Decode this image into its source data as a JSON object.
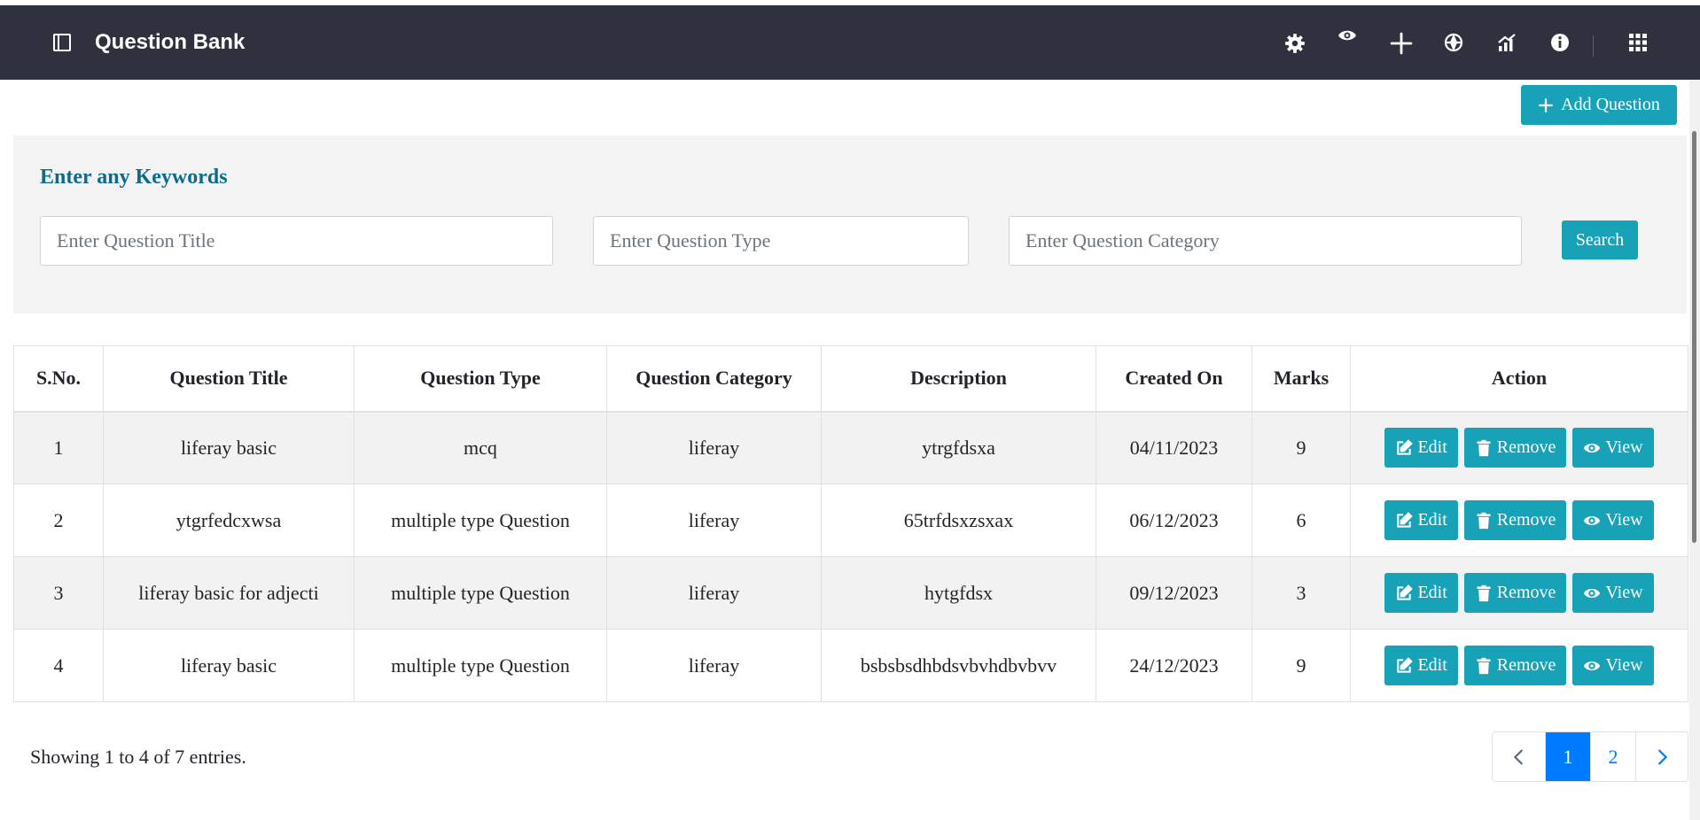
{
  "header": {
    "title": "Question Bank",
    "icons": [
      "sidebar-toggle-icon",
      "gear-icon",
      "eye-icon",
      "plus-icon",
      "compass-icon",
      "analytics-icon",
      "info-icon",
      "apps-grid-icon"
    ]
  },
  "toolbar": {
    "add_question_label": "Add Question"
  },
  "search": {
    "heading": "Enter any Keywords",
    "title_placeholder": "Enter Question Title",
    "type_placeholder": "Enter Question Type",
    "category_placeholder": "Enter Question Category",
    "button_label": "Search"
  },
  "table": {
    "columns": [
      "S.No.",
      "Question Title",
      "Question Type",
      "Question Category",
      "Description",
      "Created On",
      "Marks",
      "Action"
    ],
    "rows": [
      {
        "sno": "1",
        "title": "liferay basic",
        "type": "mcq",
        "category": "liferay",
        "description": "ytrgfdsxa",
        "created": "04/11/2023",
        "marks": "9"
      },
      {
        "sno": "2",
        "title": "ytgrfedcxwsa",
        "type": "multiple type Question",
        "category": "liferay",
        "description": "65trfdsxzsxax",
        "created": "06/12/2023",
        "marks": "6"
      },
      {
        "sno": "3",
        "title": "liferay basic for adjecti",
        "type": "multiple type Question",
        "category": "liferay",
        "description": "hytgfdsx",
        "created": "09/12/2023",
        "marks": "3"
      },
      {
        "sno": "4",
        "title": "liferay basic",
        "type": "multiple type Question",
        "category": "liferay",
        "description": "bsbsbsdhbdsvbvhdbvbvv",
        "created": "24/12/2023",
        "marks": "9"
      }
    ],
    "actions": {
      "edit": "Edit",
      "remove": "Remove",
      "view": "View"
    }
  },
  "footer": {
    "entries_text": "Showing 1 to 4 of 7 entries.",
    "pages": [
      "1",
      "2"
    ],
    "active_page": "1"
  },
  "colors": {
    "topbar": "#30313f",
    "accent": "#17a2b8",
    "heading": "#0e6a8a",
    "pager_active": "#007bff"
  }
}
